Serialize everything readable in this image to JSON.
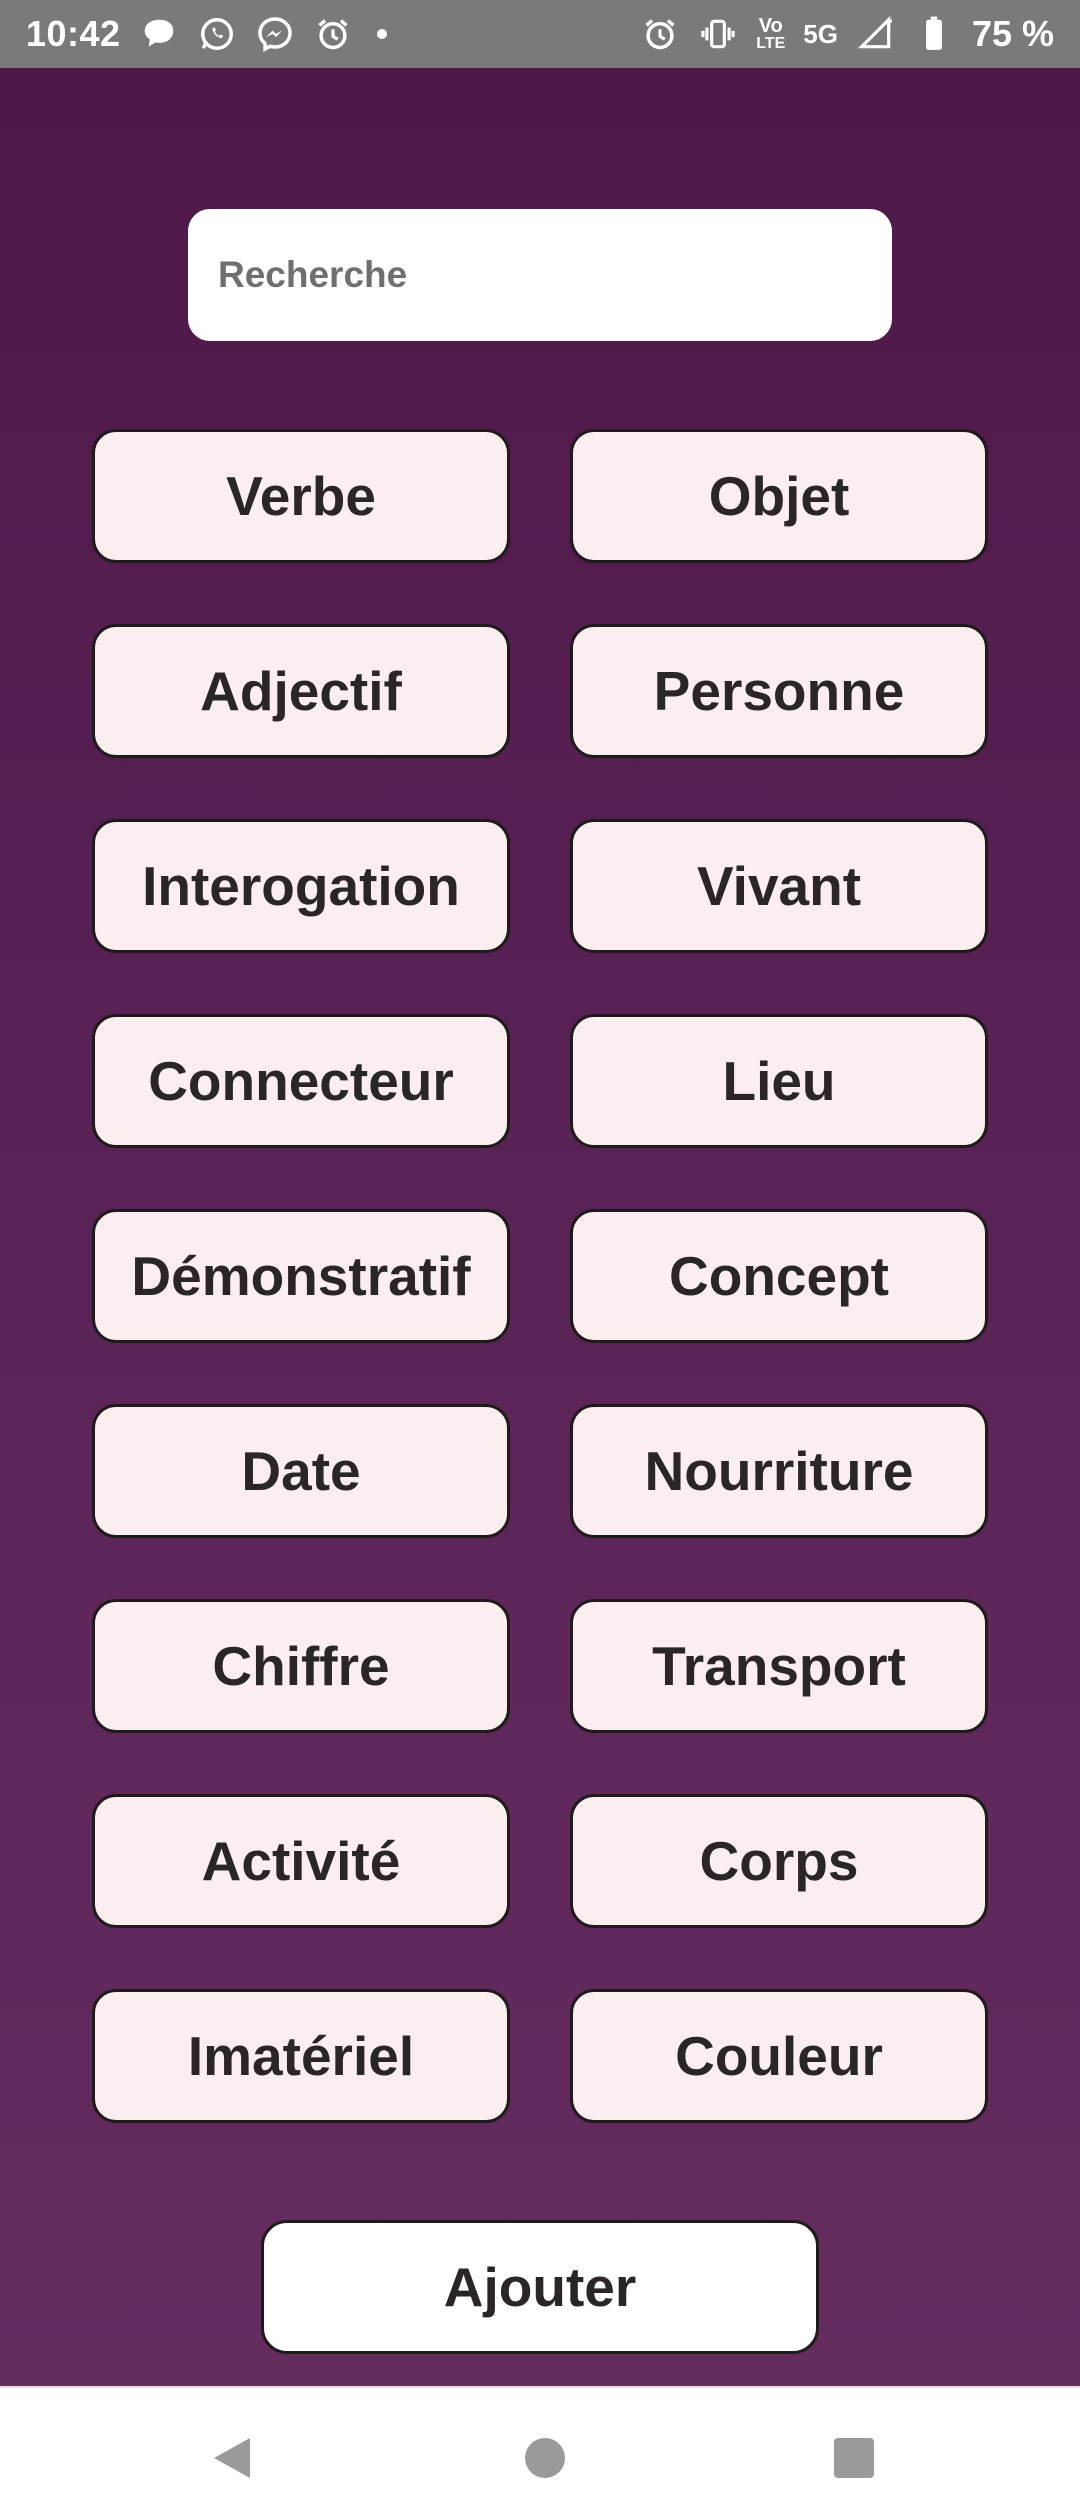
{
  "status_bar": {
    "time": "10:42",
    "left_icons": [
      "chat-bubble-icon",
      "whatsapp-icon",
      "messenger-icon",
      "alarm-icon",
      "dot-icon"
    ],
    "right_icons": [
      "alarm-icon",
      "vibrate-icon",
      "volte-icon",
      "signal-icon",
      "battery-icon"
    ],
    "volte_top": "Vo",
    "volte_bottom": "LTE",
    "network": "5G",
    "battery": "75 %"
  },
  "search": {
    "placeholder": "Recherche",
    "value": ""
  },
  "categories": [
    "Verbe",
    "Objet",
    "Adjectif",
    "Personne",
    "Interogation",
    "Vivant",
    "Connecteur",
    "Lieu",
    "Démonstratif",
    "Concept",
    "Date",
    "Nourriture",
    "Chiffre",
    "Transport",
    "Activité",
    "Corps",
    "Imatériel",
    "Couleur"
  ],
  "add_button": {
    "label": "Ajouter"
  },
  "nav_bar": {
    "icons": [
      "back-icon",
      "home-icon",
      "recents-icon"
    ]
  },
  "colors": {
    "background_top": "#4f1848",
    "background_bottom": "#652c5e",
    "button_fill": "#fbeeee",
    "button_border": "#1f1a1c",
    "status_bar": "#7a7a7a"
  }
}
